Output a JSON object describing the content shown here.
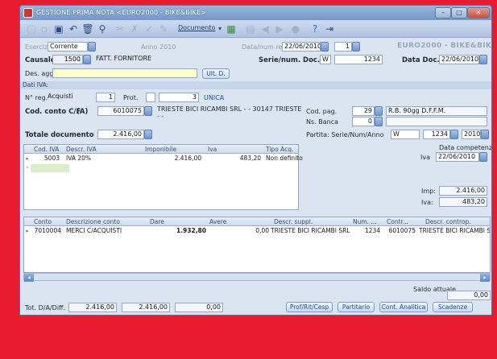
{
  "title": "GESTIONE PRIMA NOTA <EURO2000 - BIKE&BIKE>",
  "toolbar": {
    "documento": "Documento"
  },
  "header": {
    "esercizio_label": "Esercizio",
    "esercizio_value": "Corrente",
    "anno": "Anno 2010",
    "datanum_label": "Data/num reg.",
    "data_reg": "22/06/2010",
    "num_reg": "1",
    "company": "EURO2000 - BIKE&BIKE",
    "causale_label": "Causale",
    "causale_code": "1500",
    "causale_desc": "FATT. FORNITORE",
    "serie_label": "Serie/num. Doc.",
    "serie": "W",
    "num_doc": "1234",
    "data_doc_label": "Data Doc.",
    "data_doc": "22/06/2010",
    "des_agg_label": "Des. agg.",
    "ult_d": "Ult. D."
  },
  "iva_section": {
    "title": "Dati IVA:",
    "nreg_label": "N° reg.",
    "registro": "Acquisti",
    "reg_num": "1",
    "prot_label": "Prot.",
    "prot_num": "3",
    "unica": "UNICA",
    "cod_conto_label": "Cod. conto C/F",
    "cf_type": "(A)",
    "cod_conto": "6010075",
    "fornitore": "TRIESTE BICI RICAMBI SRL  -  - 30147 TRIESTE",
    "fornitore_sub": "- -",
    "cod_pag_label": "Cod. pag.",
    "cod_pag": "29",
    "cod_pag_desc": "R.B. 90gg D.F.F.M.",
    "ns_banca_label": "Ns. Banca",
    "ns_banca": "0",
    "totale_label": "Totale documento",
    "totale": "2.416,00",
    "partita_label": "Partita: Serie/Num/Anno",
    "p_serie": "W",
    "p_num": "1234",
    "p_anno": "2010",
    "competenza_label": "Data competenza",
    "iva_label": "Iva",
    "iva_date": "22/06/2010",
    "imp_label": "Imp:",
    "imp_value": "2.416,00",
    "iva_tot_label": "Iva:",
    "iva_tot": "483,20"
  },
  "iva_grid": {
    "headers": [
      "Cod. IVA",
      "Descr. IVA",
      "Imponibile",
      "Iva",
      "Tipo Acq."
    ],
    "rows": [
      {
        "cod": "5003",
        "descr": "IVA 20%",
        "imponibile": "2.416,00",
        "iva": "483,20",
        "tipo": "Non definito"
      }
    ]
  },
  "accounts_grid": {
    "headers": [
      "Conto",
      "Descrizione conto",
      "Dare",
      "Avere",
      "Descr. suppl.",
      "Num. ...",
      "Contr...",
      "Descr. controp."
    ],
    "rows": [
      {
        "conto": "7010004",
        "descr": "MERCI C/ACQUISTI",
        "dare": "1.932,80",
        "avere": "0,00",
        "suppl": "TRIESTE BICI RICAMBI SRL",
        "num": "1234",
        "contr": "6010075",
        "controp": "TRIESTE BICI RICAMBI S"
      }
    ]
  },
  "footer": {
    "saldo_label": "Saldo attuale",
    "saldo": "0,00",
    "tot_label": "Tot. D/A/Diff.",
    "tot_d": "2.416,00",
    "tot_a": "2.416,00",
    "tot_diff": "0,00",
    "buttons": [
      "Prof/Rit/Cesp",
      "Partitario",
      "Cont. Analitica",
      "Scadenze"
    ]
  }
}
